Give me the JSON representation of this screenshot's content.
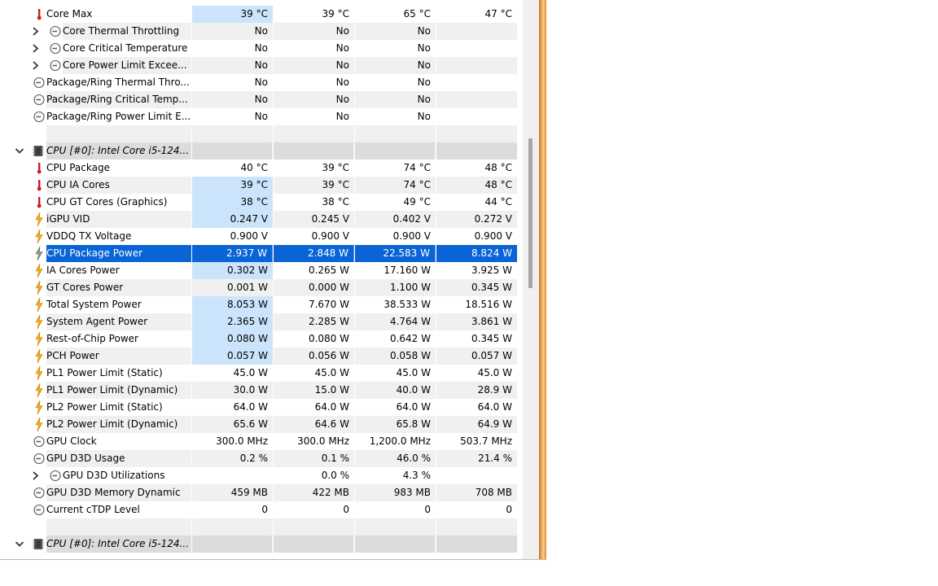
{
  "rows": [
    {
      "name": "Core Max",
      "v1": "39 °C",
      "v2": "39 °C",
      "v3": "65 °C",
      "v4": "47 °C"
    },
    {
      "name": "Core Thermal Throttling",
      "v1": "No",
      "v2": "No",
      "v3": "No",
      "v4": ""
    },
    {
      "name": "Core Critical Temperature",
      "v1": "No",
      "v2": "No",
      "v3": "No",
      "v4": ""
    },
    {
      "name": "Core Power Limit Excee...",
      "v1": "No",
      "v2": "No",
      "v3": "No",
      "v4": ""
    },
    {
      "name": "Package/Ring Thermal Thro...",
      "v1": "No",
      "v2": "No",
      "v3": "No",
      "v4": ""
    },
    {
      "name": "Package/Ring Critical Temp...",
      "v1": "No",
      "v2": "No",
      "v3": "No",
      "v4": ""
    },
    {
      "name": "Package/Ring Power Limit E...",
      "v1": "No",
      "v2": "No",
      "v3": "No",
      "v4": ""
    },
    {
      "name": "CPU [#0]: Intel Core i5-124..."
    },
    {
      "name": "CPU Package",
      "v1": "40 °C",
      "v2": "39 °C",
      "v3": "74 °C",
      "v4": "48 °C"
    },
    {
      "name": "CPU IA Cores",
      "v1": "39 °C",
      "v2": "39 °C",
      "v3": "74 °C",
      "v4": "48 °C"
    },
    {
      "name": "CPU GT Cores (Graphics)",
      "v1": "38 °C",
      "v2": "38 °C",
      "v3": "49 °C",
      "v4": "44 °C"
    },
    {
      "name": "iGPU VID",
      "v1": "0.247 V",
      "v2": "0.245 V",
      "v3": "0.402 V",
      "v4": "0.272 V"
    },
    {
      "name": "VDDQ TX Voltage",
      "v1": "0.900 V",
      "v2": "0.900 V",
      "v3": "0.900 V",
      "v4": "0.900 V"
    },
    {
      "name": "CPU Package Power",
      "v1": "2.937 W",
      "v2": "2.848 W",
      "v3": "22.583 W",
      "v4": "8.824 W"
    },
    {
      "name": "IA Cores Power",
      "v1": "0.302 W",
      "v2": "0.265 W",
      "v3": "17.160 W",
      "v4": "3.925 W"
    },
    {
      "name": "GT Cores Power",
      "v1": "0.001 W",
      "v2": "0.000 W",
      "v3": "1.100 W",
      "v4": "0.345 W"
    },
    {
      "name": "Total System Power",
      "v1": "8.053 W",
      "v2": "7.670 W",
      "v3": "38.533 W",
      "v4": "18.516 W"
    },
    {
      "name": "System Agent Power",
      "v1": "2.365 W",
      "v2": "2.285 W",
      "v3": "4.764 W",
      "v4": "3.861 W"
    },
    {
      "name": "Rest-of-Chip Power",
      "v1": "0.080 W",
      "v2": "0.080 W",
      "v3": "0.642 W",
      "v4": "0.345 W"
    },
    {
      "name": "PCH Power",
      "v1": "0.057 W",
      "v2": "0.056 W",
      "v3": "0.058 W",
      "v4": "0.057 W"
    },
    {
      "name": "PL1 Power Limit (Static)",
      "v1": "45.0 W",
      "v2": "45.0 W",
      "v3": "45.0 W",
      "v4": "45.0 W"
    },
    {
      "name": "PL1 Power Limit (Dynamic)",
      "v1": "30.0 W",
      "v2": "15.0 W",
      "v3": "40.0 W",
      "v4": "28.9 W"
    },
    {
      "name": "PL2 Power Limit (Static)",
      "v1": "64.0 W",
      "v2": "64.0 W",
      "v3": "64.0 W",
      "v4": "64.0 W"
    },
    {
      "name": "PL2 Power Limit (Dynamic)",
      "v1": "65.6 W",
      "v2": "64.6 W",
      "v3": "65.8 W",
      "v4": "64.9 W"
    },
    {
      "name": "GPU Clock",
      "v1": "300.0 MHz",
      "v2": "300.0 MHz",
      "v3": "1,200.0 MHz",
      "v4": "503.7 MHz"
    },
    {
      "name": "GPU D3D Usage",
      "v1": "0.2 %",
      "v2": "0.1 %",
      "v3": "46.0 %",
      "v4": "21.4 %"
    },
    {
      "name": "GPU D3D Utilizations",
      "v1": "",
      "v2": "0.0 %",
      "v3": "4.3 %",
      "v4": ""
    },
    {
      "name": "GPU D3D Memory Dynamic",
      "v1": "459 MB",
      "v2": "422 MB",
      "v3": "983 MB",
      "v4": "708 MB"
    },
    {
      "name": "Current cTDP Level",
      "v1": "0",
      "v2": "0",
      "v3": "0",
      "v4": "0"
    },
    {
      "name": "CPU [#0]: Intel Core i5-124..."
    }
  ],
  "colors": {
    "selection": "#0a64d6",
    "highlight": "#cce4fb",
    "row_alt": "#f0f0f0",
    "group_bg": "#dcdcdc",
    "thermometer": "#cc1d1d",
    "bolt": "#f2b01b"
  },
  "icons": {
    "thermometer": "thermometer-icon",
    "bolt": "lightning-bolt-icon",
    "clock": "clock-gauge-icon",
    "chip": "cpu-chip-icon",
    "expand": "chevron-right-icon",
    "collapse": "chevron-down-icon"
  }
}
